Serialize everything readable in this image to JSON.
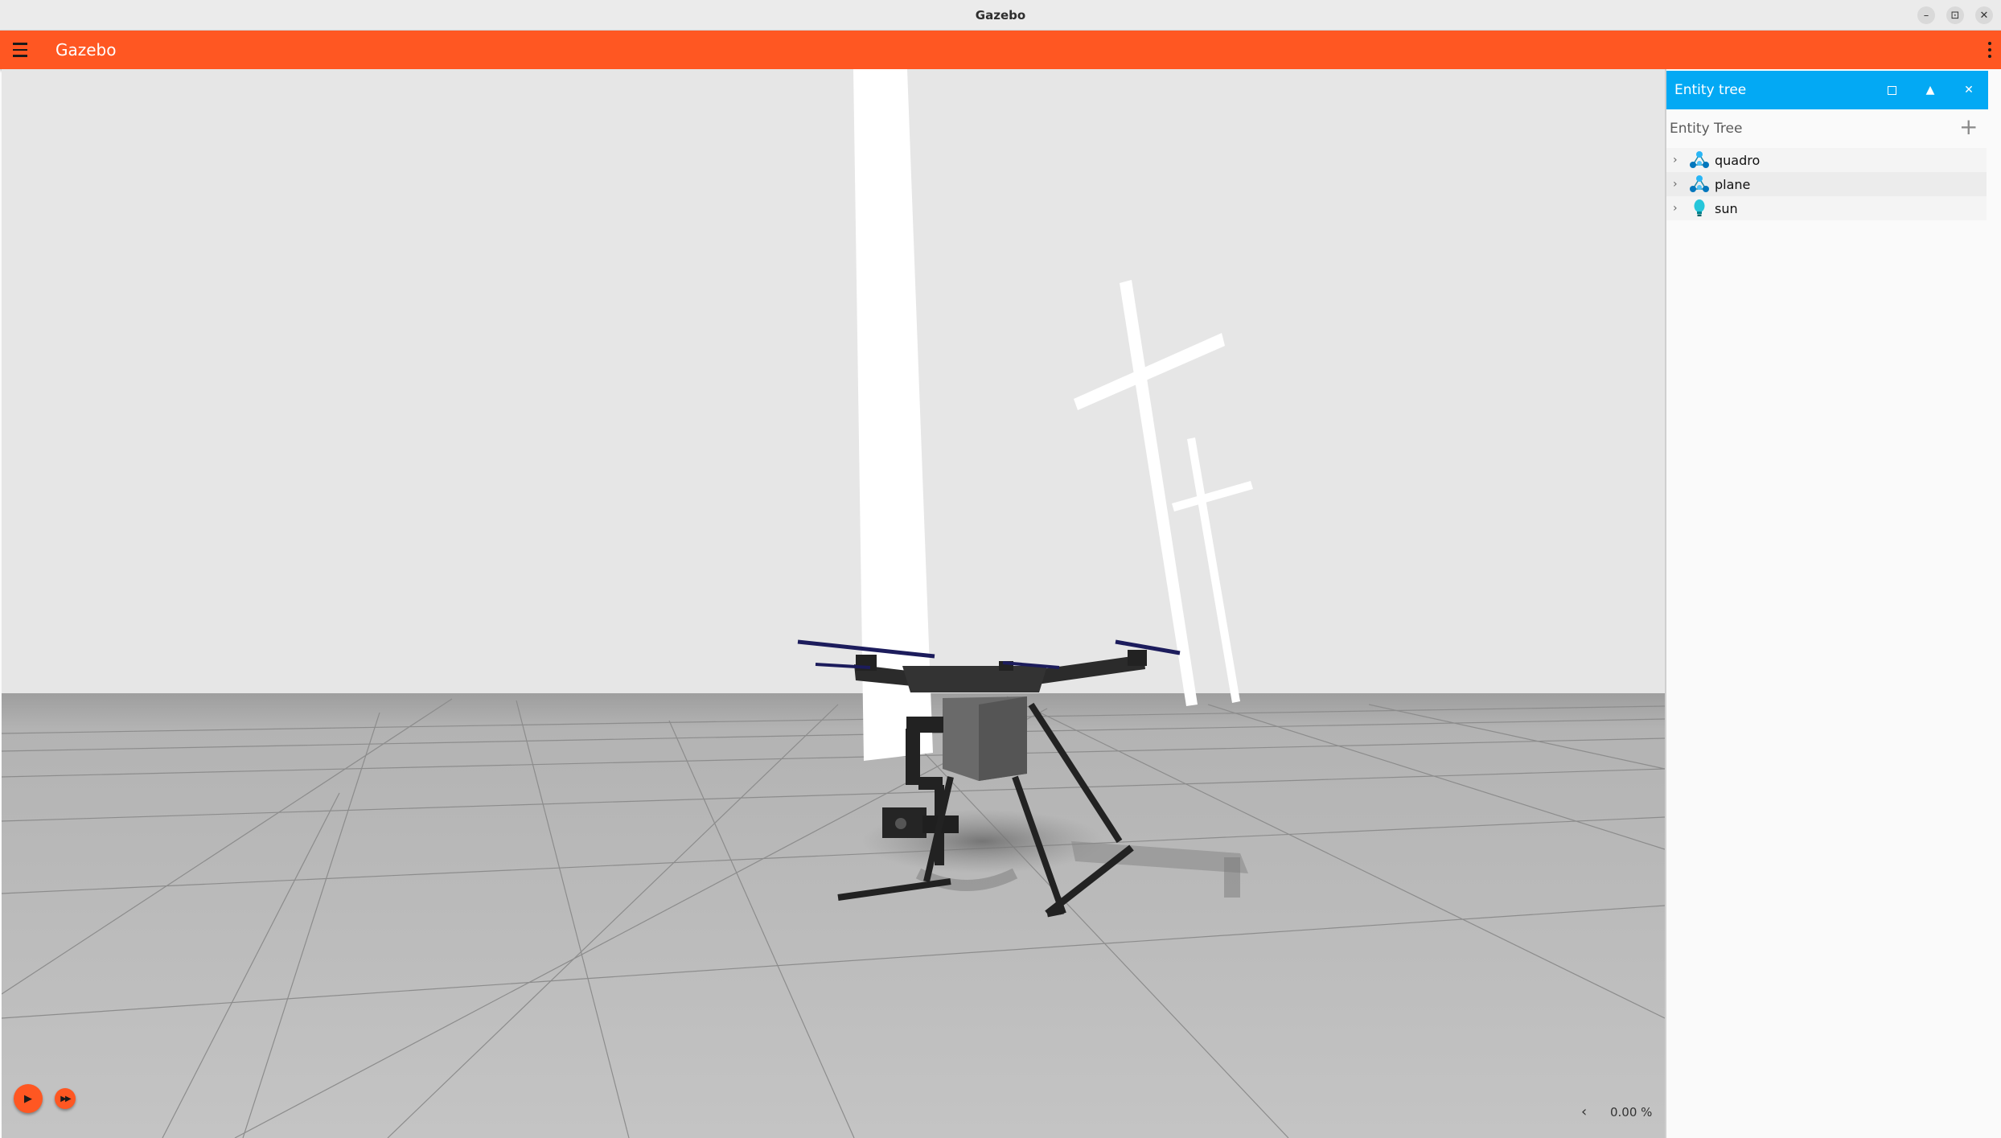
{
  "window": {
    "title": "Gazebo",
    "controls": [
      "–",
      "⊡",
      "✕"
    ]
  },
  "appbar": {
    "title": "Gazebo"
  },
  "panel": {
    "header_title": "Entity tree",
    "tree_title": "Entity Tree",
    "add_symbol": "+",
    "entities": [
      {
        "name": "quadro",
        "icon": "model-icon"
      },
      {
        "name": "plane",
        "icon": "model-icon"
      },
      {
        "name": "sun",
        "icon": "light-icon"
      }
    ]
  },
  "controls": {
    "play_symbol": "▶",
    "step_symbol": "▶▶",
    "rtf_arrow": "‹",
    "rtf_value": "0.00 %"
  },
  "colors": {
    "accent": "#ff5722",
    "panel_header": "#03a9f4",
    "sky": "#e6e6e6",
    "ground": "#bdbdbd"
  }
}
